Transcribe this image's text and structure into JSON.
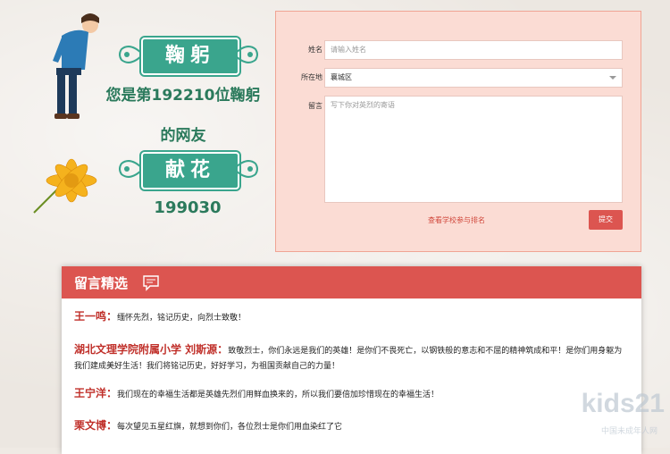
{
  "left": {
    "banner_bow": "鞠躬",
    "visitor_line1": "您是第192210位鞠躬",
    "visitor_line2": "的网友",
    "banner_flower": "献花",
    "flower_count": "199030"
  },
  "form": {
    "name_label": "姓名",
    "name_placeholder": "请输入姓名",
    "location_label": "所在地",
    "location_value": "襄城区",
    "message_label": "留言",
    "message_placeholder": "写下你对英烈的寄语",
    "rank_link": "查看学校参与排名",
    "submit_label": "提交"
  },
  "messages": {
    "title": "留言精选",
    "items": [
      {
        "author": "王一鸣：",
        "text": "缅怀先烈，铭记历史，向烈士致敬！"
      },
      {
        "author": "湖北文理学院附属小学 刘斯源：",
        "text": "致敬烈士，你们永远是我们的英雄！是你们不畏死亡，以钢铁般的意志和不屈的精神筑成和平！是你们用身躯为我们建成美好生活！我们将铭记历史，好好学习，为祖国贡献自己的力量！"
      },
      {
        "author": "王宁洋：",
        "text": "我们现在的幸福生活都是英雄先烈们用鲜血换来的，所以我们要倍加珍惜现在的幸福生活！"
      },
      {
        "author": "栗文博：",
        "text": "每次望见五星红旗，就想到你们，各位烈士是你们用血染红了它"
      }
    ]
  },
  "watermark": {
    "logo": "kids21",
    "sub": "中国未成年人网"
  },
  "colors": {
    "accent_red": "#dc5550",
    "banner_green": "#3aa58d",
    "text_green": "#2b7a5c"
  }
}
